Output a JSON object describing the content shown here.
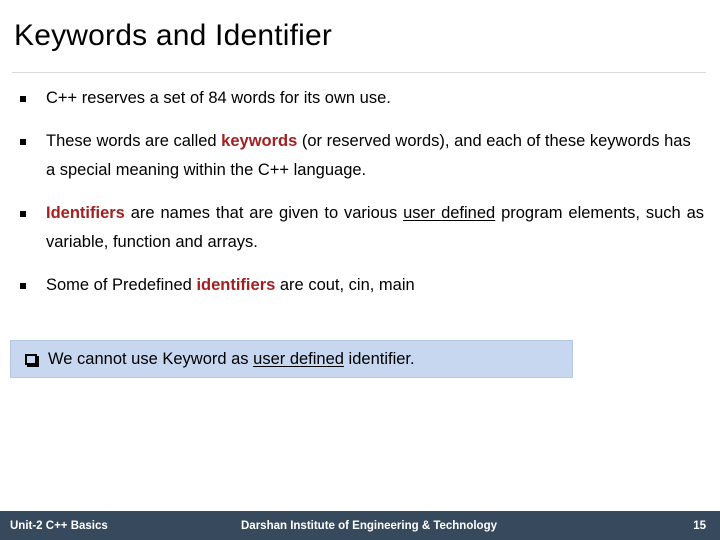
{
  "slide": {
    "title": "Keywords and Identifier",
    "colors": {
      "accent_red": "#a32020",
      "callout_fill": "#c6d7ef",
      "callout_border": "#b4c8e4",
      "footer_bar": "#37495c",
      "rule": "#d9d9d9",
      "text": "#000000"
    },
    "bullets": [
      {
        "marker": "square-bullet",
        "runs": [
          {
            "text": "C++ reserves a set of 84 words for its own use.",
            "style": "normal"
          }
        ]
      },
      {
        "marker": "square-bullet",
        "runs": [
          {
            "text": "These words are called ",
            "style": "normal"
          },
          {
            "text": "keywords",
            "style": "red-bold"
          },
          {
            "text": " (or reserved words), and each of these keywords has a special meaning within the C++ language.",
            "style": "normal"
          }
        ]
      },
      {
        "marker": "square-bullet",
        "justified": true,
        "runs": [
          {
            "text": "Identifiers",
            "style": "red-bold"
          },
          {
            "text": " are names that are given to various ",
            "style": "normal"
          },
          {
            "text": "user ",
            "style": "underline"
          },
          {
            "text": "defined",
            "style": "underline"
          },
          {
            "text": " program elements, such as variable, function and arrays.",
            "style": "normal"
          }
        ]
      },
      {
        "marker": "square-bullet",
        "runs": [
          {
            "text": "Some of Predefined ",
            "style": "normal"
          },
          {
            "text": "identifiers",
            "style": "red-bold"
          },
          {
            "text": " are cout, cin, main",
            "style": "normal"
          }
        ]
      }
    ],
    "callout": {
      "marker": "hollow-square-bullet",
      "runs": [
        {
          "text": "We cannot use Keyword as ",
          "style": "normal"
        },
        {
          "text": "user defined",
          "style": "underline"
        },
        {
          "text": " identifier.",
          "style": "normal"
        }
      ]
    },
    "footer": {
      "left": "Unit-2 C++ Basics",
      "center": "Darshan Institute of Engineering & Technology",
      "page_number": "15"
    }
  }
}
